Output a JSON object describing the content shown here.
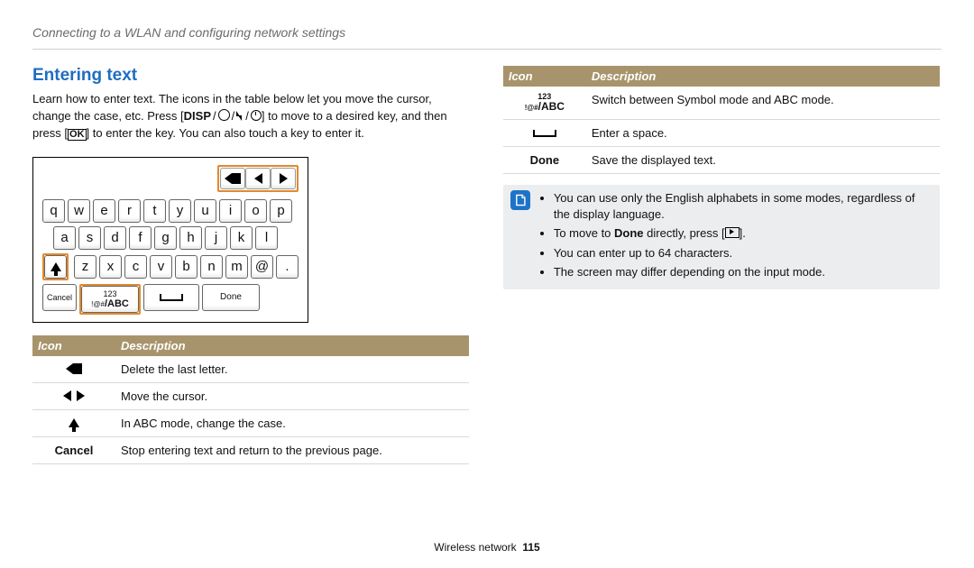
{
  "breadcrumb": "Connecting to a WLAN and configuring network settings",
  "section_title": "Entering text",
  "intro_a": "Learn how to enter text. The icons in the table below let you move the cursor, change the case, etc. Press [",
  "disp_label": "DISP",
  "intro_b": "] to move to a desired key, and then press [",
  "ok_label": "OK",
  "intro_c": "] to enter the key. You can also touch a key to enter it.",
  "keyboard": {
    "row1": [
      "q",
      "w",
      "e",
      "r",
      "t",
      "y",
      "u",
      "i",
      "o",
      "p"
    ],
    "row2": [
      "a",
      "s",
      "d",
      "f",
      "g",
      "h",
      "j",
      "k",
      "l"
    ],
    "row3": [
      "z",
      "x",
      "c",
      "v",
      "b",
      "n",
      "m",
      "@",
      "."
    ],
    "cancel_label": "Cancel",
    "mode_top": "123",
    "mode_sub": "!@#",
    "mode_abc": "/ABC",
    "done_label": "Done"
  },
  "left_table": {
    "h1": "Icon",
    "h2": "Description",
    "rows": [
      {
        "icon": "delete",
        "desc": "Delete the last letter."
      },
      {
        "icon": "moveLR",
        "desc": "Move the cursor."
      },
      {
        "icon": "shift",
        "desc": "In ABC mode, change the case."
      },
      {
        "icon": "Cancel",
        "text": "Cancel",
        "desc": "Stop entering text and return to the previous page."
      }
    ]
  },
  "right_table": {
    "h1": "Icon",
    "h2": "Description",
    "rows": [
      {
        "icon": "mode",
        "desc": "Switch between Symbol mode and ABC mode."
      },
      {
        "icon": "space",
        "desc": "Enter a space."
      },
      {
        "icon": "Done",
        "text": "Done",
        "desc": "Save the displayed text."
      }
    ]
  },
  "note": {
    "items": [
      "You can use only the English alphabets in some modes, regardless of the display language.",
      null,
      "You can enter up to 64 characters.",
      "The screen may differ depending on the input mode."
    ],
    "done_move_a": "To move to ",
    "done_move_b": "Done",
    "done_move_c": " directly, press [",
    "done_move_d": "]."
  },
  "footer": {
    "section": "Wireless network",
    "page": "115"
  }
}
